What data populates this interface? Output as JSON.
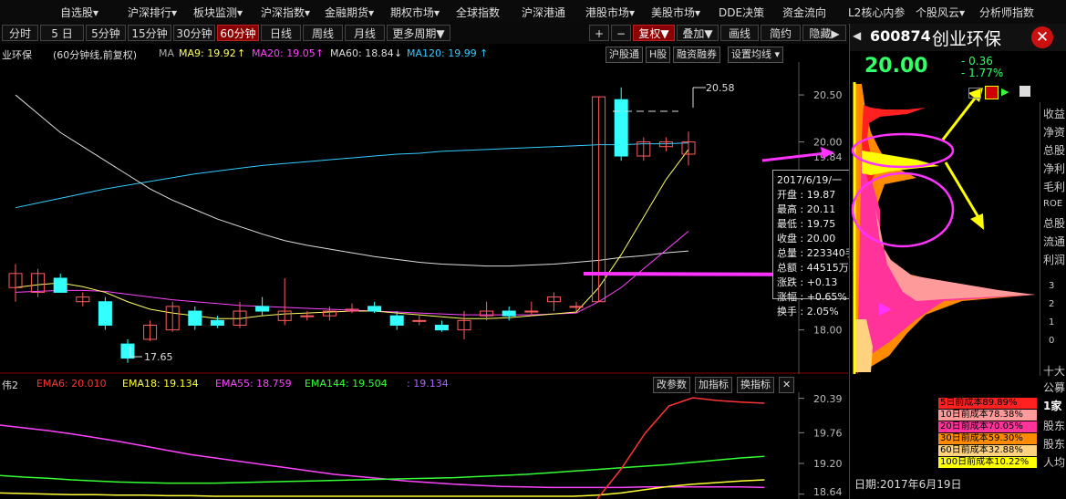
{
  "menu": [
    "自选股",
    "沪深排行",
    "板块监测",
    "沪深指数",
    "金融期货",
    "期权市场",
    "全球指数",
    "沪深港通",
    "港股市场",
    "美股市场",
    "DDE决策",
    "资金流向",
    "L2核心内参",
    "个股风云",
    "分析师指数"
  ],
  "toolbar": {
    "periods": [
      "分时",
      "5 日",
      "5分钟",
      "15分钟",
      "30分钟",
      "60分钟",
      "日线",
      "周线",
      "月线",
      "更多周期"
    ],
    "active_period": "60分钟",
    "plus": "+",
    "minus": "−",
    "fuquan": "复权",
    "overlay": "叠加",
    "draw": "画线",
    "simple": "简约",
    "hide": "隐藏"
  },
  "legend": {
    "stock": "业环保",
    "desc": "(60分钟线,前复权)",
    "ma_label": "MA",
    "ma9": "MA9: 19.92",
    "ma20": "MA20: 19.05",
    "ma60": "MA60: 18.84",
    "ma120": "MA120: 19.99",
    "arrow_up": "↑",
    "arrow_down": "↓",
    "buttons": [
      "沪股通",
      "H股",
      "融资融券",
      "设置均线"
    ]
  },
  "price_axis": [
    "20.50",
    "20.00",
    "19.84",
    "18.00"
  ],
  "annotations": {
    "high": "20.58",
    "low": "17.65"
  },
  "tooltip": {
    "date": "2017/6/19/一",
    "rows": [
      "开盘 : 19.87",
      "最高 : 20.11",
      "最低 : 19.75",
      "收盘 : 20.00",
      "总量 : 223340手",
      "总额 : 44515万元",
      "涨跌 : +0.13",
      "涨幅 : +0.65%",
      "换手 : 2.05%"
    ]
  },
  "sub_legend": {
    "name": "伟2",
    "ema6": "EMA6: 20.010",
    "ema18": "EMA18: 19.134",
    "ema55": "EMA55: 18.759",
    "ema144": "EMA144: 19.504",
    "extra": ": 19.134",
    "buttons": [
      "改参数",
      "加指标",
      "换指标",
      "✕"
    ]
  },
  "sub_axis": [
    "20.39",
    "19.76",
    "19.20",
    "18.64"
  ],
  "quote": {
    "code": "600874",
    "name": "创业环保",
    "price": "20.00",
    "change": "- 0.36",
    "pct": "- 1.77%"
  },
  "side_labels": [
    "收益",
    "净资",
    "总股",
    "净利",
    "毛利",
    "ROE",
    "总股",
    "流通",
    "利润",
    "十大",
    "公募",
    "1家",
    "股东",
    "股东",
    "人均"
  ],
  "side_axis": [
    "3",
    "2",
    "1",
    "0"
  ],
  "cost_table": [
    {
      "text": "5日前成本89.89%",
      "color": "#ff2020"
    },
    {
      "text": "10日前成本78.38%",
      "color": "#ff9a9a"
    },
    {
      "text": "20日前成本70.05%",
      "color": "#ff3399"
    },
    {
      "text": "30日前成本59.30%",
      "color": "#ff8c00"
    },
    {
      "text": "60日前成本32.88%",
      "color": "#ffd27f"
    },
    {
      "text": "100日前成本10.22%",
      "color": "#ffff00"
    }
  ],
  "side_date": "日期:2017年6月19日",
  "chart_data": {
    "type": "candlestick",
    "candles": [
      [
        18.45,
        18.6,
        18.3,
        18.7
      ],
      [
        18.4,
        18.6,
        18.35,
        18.65
      ],
      [
        18.55,
        18.4,
        18.4,
        18.6
      ],
      [
        18.3,
        18.35,
        18.25,
        18.4
      ],
      [
        18.3,
        18.05,
        18.0,
        18.35
      ],
      [
        17.85,
        17.7,
        17.65,
        17.9
      ],
      [
        17.9,
        18.05,
        17.88,
        18.1
      ],
      [
        18.0,
        18.25,
        17.98,
        18.3
      ],
      [
        18.2,
        18.05,
        18.0,
        18.25
      ],
      [
        18.1,
        18.05,
        18.02,
        18.15
      ],
      [
        18.05,
        18.2,
        18.02,
        18.3
      ],
      [
        18.25,
        18.2,
        18.15,
        18.35
      ],
      [
        18.1,
        18.2,
        18.05,
        18.55
      ],
      [
        18.15,
        18.15,
        18.1,
        18.2
      ],
      [
        18.15,
        18.2,
        18.1,
        18.25
      ],
      [
        18.2,
        18.22,
        18.18,
        18.28
      ],
      [
        18.25,
        18.2,
        18.18,
        18.3
      ],
      [
        18.15,
        18.05,
        18.0,
        18.2
      ],
      [
        18.1,
        18.1,
        18.05,
        18.15
      ],
      [
        18.05,
        18.0,
        17.98,
        18.1
      ],
      [
        18.0,
        18.1,
        17.9,
        18.2
      ],
      [
        18.15,
        18.2,
        18.1,
        18.3
      ],
      [
        18.2,
        18.15,
        18.1,
        18.25
      ],
      [
        18.2,
        18.2,
        18.15,
        18.3
      ],
      [
        18.3,
        18.35,
        18.2,
        18.4
      ],
      [
        18.25,
        18.25,
        18.2,
        18.3
      ],
      [
        18.3,
        20.48,
        18.3,
        20.48
      ],
      [
        20.45,
        19.85,
        19.8,
        20.58
      ],
      [
        19.85,
        20.0,
        19.8,
        20.05
      ],
      [
        19.95,
        20.0,
        19.9,
        20.05
      ],
      [
        19.87,
        20.0,
        19.75,
        20.11
      ]
    ],
    "ma9": [
      18.45,
      18.48,
      18.5,
      18.46,
      18.4,
      18.3,
      18.22,
      18.18,
      18.15,
      18.12,
      18.12,
      18.15,
      18.17,
      18.18,
      18.19,
      18.2,
      18.2,
      18.18,
      18.16,
      18.14,
      18.12,
      18.12,
      18.13,
      18.15,
      18.17,
      18.19,
      18.45,
      18.8,
      19.2,
      19.6,
      19.92
    ],
    "ma20": [
      18.4,
      18.41,
      18.42,
      18.42,
      18.41,
      18.38,
      18.35,
      18.32,
      18.3,
      18.28,
      18.26,
      18.25,
      18.24,
      18.23,
      18.22,
      18.21,
      18.2,
      18.19,
      18.18,
      18.17,
      18.16,
      18.16,
      18.16,
      18.16,
      18.17,
      18.18,
      18.3,
      18.45,
      18.65,
      18.85,
      19.05
    ],
    "ma60": [
      20.5,
      20.3,
      20.1,
      19.95,
      19.8,
      19.65,
      19.5,
      19.38,
      19.28,
      19.18,
      19.1,
      19.02,
      18.95,
      18.9,
      18.86,
      18.82,
      18.78,
      18.75,
      18.72,
      18.7,
      18.69,
      18.68,
      18.68,
      18.69,
      18.7,
      18.72,
      18.74,
      18.77,
      18.79,
      18.82,
      18.84
    ],
    "ma120": [
      19.3,
      19.35,
      19.4,
      19.45,
      19.5,
      19.54,
      19.58,
      19.62,
      19.66,
      19.69,
      19.72,
      19.75,
      19.77,
      19.79,
      19.81,
      19.83,
      19.85,
      19.87,
      19.88,
      19.9,
      19.91,
      19.92,
      19.93,
      19.94,
      19.95,
      19.96,
      19.97,
      19.97,
      19.98,
      19.98,
      19.99
    ],
    "ylim": [
      17.55,
      20.85
    ],
    "sub": {
      "ema6": [
        null,
        null,
        null,
        null,
        null,
        null,
        null,
        null,
        null,
        null,
        null,
        null,
        null,
        null,
        null,
        null,
        null,
        null,
        null,
        null,
        null,
        null,
        null,
        null,
        null,
        18.55,
        19.1,
        19.75,
        20.25,
        20.4,
        20.35,
        20.32,
        20.3
      ],
      "ema18": [
        18.66,
        18.65,
        18.64,
        18.63,
        18.63,
        18.62,
        18.62,
        18.61,
        18.61,
        18.6,
        18.6,
        18.6,
        18.6,
        18.6,
        18.6,
        18.6,
        18.6,
        18.6,
        18.6,
        18.6,
        18.6,
        18.6,
        18.6,
        18.6,
        18.6,
        18.62,
        18.66,
        18.72,
        18.78,
        18.82,
        18.85,
        18.88,
        18.9
      ],
      "ema55": [
        19.9,
        19.85,
        19.8,
        19.74,
        19.67,
        19.6,
        19.52,
        19.44,
        19.36,
        19.3,
        19.24,
        19.18,
        19.12,
        19.06,
        19.0,
        18.96,
        18.92,
        18.88,
        18.85,
        18.82,
        18.8,
        18.78,
        18.77,
        18.76,
        18.76,
        18.76,
        18.76,
        18.77,
        18.77,
        18.77,
        18.77,
        18.77,
        18.76
      ],
      "ema144": [
        18.98,
        18.95,
        18.93,
        18.9,
        18.88,
        18.86,
        18.85,
        18.84,
        18.84,
        18.84,
        18.85,
        18.86,
        18.87,
        18.88,
        18.89,
        18.9,
        18.91,
        18.92,
        18.93,
        18.94,
        18.96,
        18.98,
        19.0,
        19.03,
        19.06,
        19.09,
        19.12,
        19.15,
        19.18,
        19.22,
        19.26,
        19.3,
        19.33
      ],
      "ylim": [
        18.55,
        20.5
      ]
    }
  }
}
